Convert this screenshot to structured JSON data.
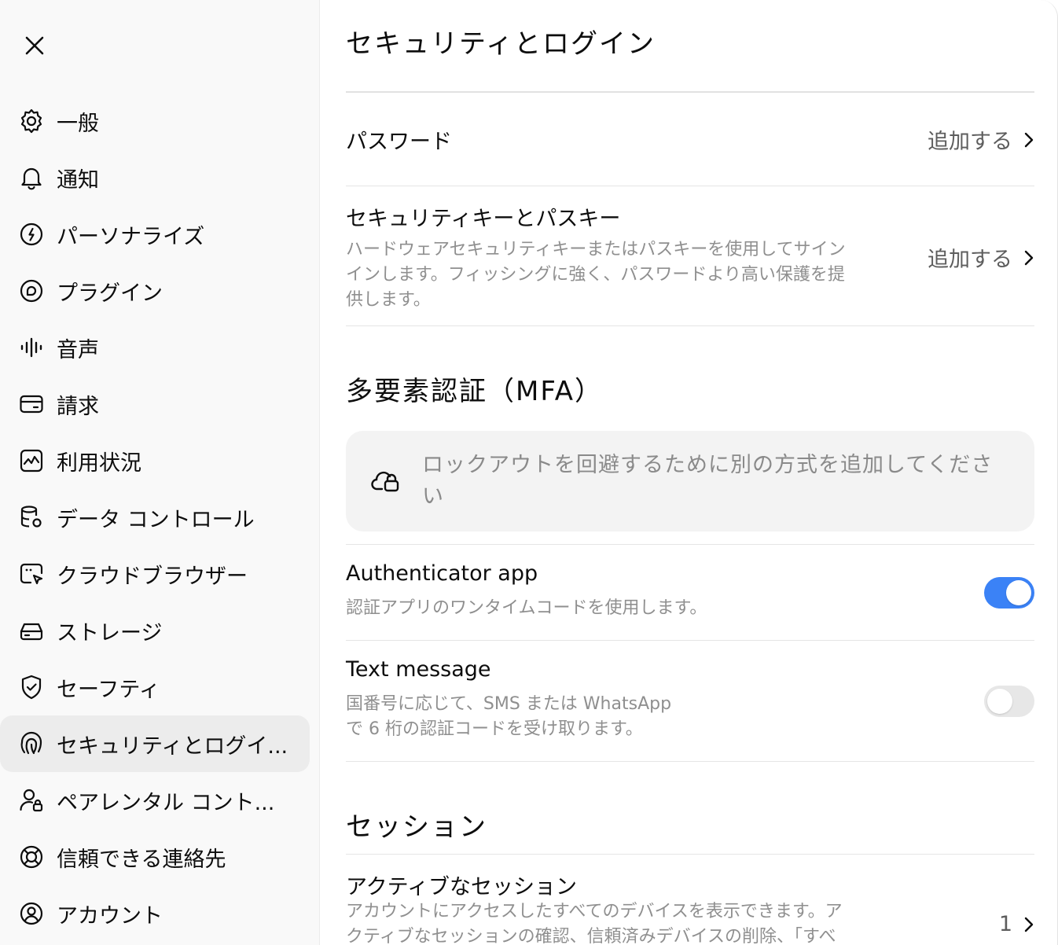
{
  "sidebar": {
    "items": [
      {
        "label": "一般",
        "icon": "gear-icon"
      },
      {
        "label": "通知",
        "icon": "bell-icon"
      },
      {
        "label": "パーソナライズ",
        "icon": "personalize-icon"
      },
      {
        "label": "プラグイン",
        "icon": "plugin-icon"
      },
      {
        "label": "音声",
        "icon": "waveform-icon"
      },
      {
        "label": "請求",
        "icon": "wallet-icon"
      },
      {
        "label": "利用状況",
        "icon": "usage-chart-icon"
      },
      {
        "label": "データ コントロール",
        "icon": "database-gear-icon"
      },
      {
        "label": "クラウドブラウザー",
        "icon": "cloud-browser-icon"
      },
      {
        "label": "ストレージ",
        "icon": "storage-icon"
      },
      {
        "label": "セーフティ",
        "icon": "shield-check-icon"
      },
      {
        "label": "セキュリティとログイ...",
        "icon": "fingerprint-icon",
        "active": true
      },
      {
        "label": "ペアレンタル コント...",
        "icon": "parental-lock-icon"
      },
      {
        "label": "信頼できる連絡先",
        "icon": "lifebuoy-icon"
      },
      {
        "label": "アカウント",
        "icon": "account-icon"
      }
    ]
  },
  "main": {
    "title": "セキュリティとログイン",
    "password": {
      "title": "パスワード",
      "action": "追加する"
    },
    "passkey": {
      "title": "セキュリティキーとパスキー",
      "desc_line1": "ハードウェアセキュリティキーまたはパスキーを使用してサイン",
      "desc_line2": "インします。フィッシングに強く、パスワードより高い保護を提",
      "desc_line3": "供します。",
      "action": "追加する"
    },
    "mfa": {
      "title": "多要素認証（MFA）",
      "callout_line1": "ロックアウトを回避するために別の方式を追加してくださ",
      "callout_line2": "い",
      "authenticator": {
        "title": "Authenticator app",
        "desc": "認証アプリのワンタイムコードを使用します。",
        "enabled": true
      },
      "sms": {
        "title": "Text message",
        "desc_line1": "国番号に応じて、SMS または WhatsApp",
        "desc_line2": "で 6 桁の認証コードを受け取ります。",
        "enabled": false
      }
    },
    "sessions": {
      "title": "セッション",
      "active": {
        "title": "アクティブなセッション",
        "desc_line1": "アカウントにアクセスしたすべてのデバイスを表示できます。ア",
        "desc_line2": "クティブなセッションの確認、信頼済みデバイスの削除、「すべ",
        "count": "1"
      }
    }
  },
  "colors": {
    "toggle_on": "#3b82f6",
    "toggle_off": "#e7e7e7",
    "active_item": "#ececec",
    "muted_text": "#8f8f8f"
  }
}
